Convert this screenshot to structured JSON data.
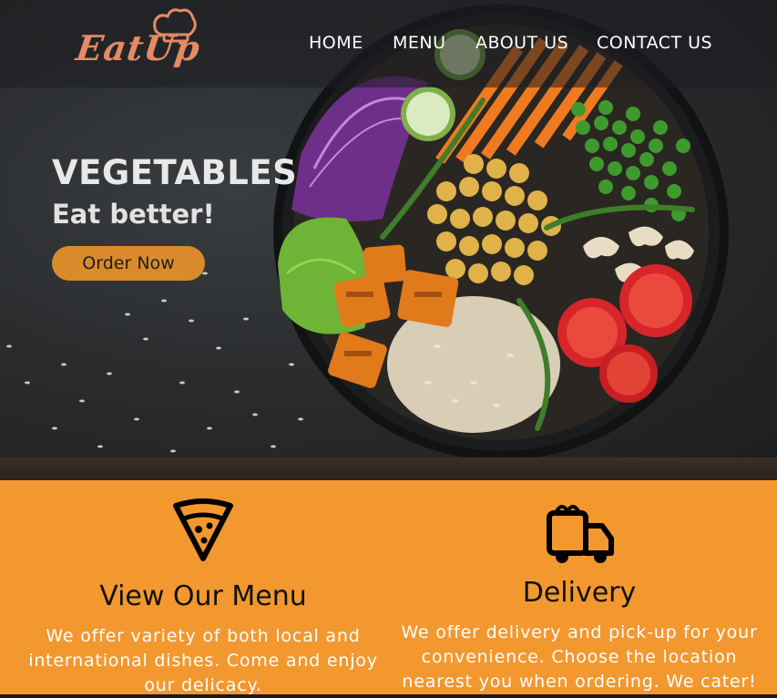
{
  "brand": {
    "logo_text": "EatUp"
  },
  "nav": {
    "items": [
      {
        "label": "HOME"
      },
      {
        "label": "MENU"
      },
      {
        "label": "ABOUT US"
      },
      {
        "label": "CONTACT US"
      }
    ]
  },
  "hero": {
    "title": "VEGETABLES",
    "subtitle": "Eat better!",
    "cta_label": "Order Now"
  },
  "features": [
    {
      "icon": "pizza-slice-icon",
      "title": "View Our Menu",
      "text": "We offer variety of both local and international dishes. Come and enjoy our delicacy."
    },
    {
      "icon": "delivery-truck-icon",
      "title": "Delivery",
      "text": "We offer delivery and pick-up for your convenience. Choose the location nearest you when ordering. We cater!"
    }
  ],
  "colors": {
    "accent_orange": "#f3982f",
    "button_orange": "#d98b2b",
    "logo_salmon": "#e58a63"
  }
}
